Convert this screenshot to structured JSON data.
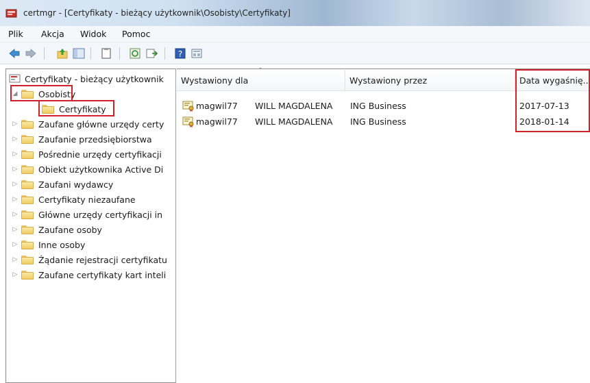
{
  "window": {
    "title": "certmgr - [Certyfikaty - bieżący użytkownik\\Osobisty\\Certyfikaty]"
  },
  "menu": {
    "items": [
      "Plik",
      "Akcja",
      "Widok",
      "Pomoc"
    ]
  },
  "toolbar": {
    "icons": [
      "back-icon",
      "forward-icon",
      "up-folder-icon",
      "show-hide-tree-icon",
      "clipboard-icon",
      "refresh-icon",
      "export-list-icon",
      "help-icon",
      "console-view-icon"
    ]
  },
  "tree": {
    "root": "Certyfikaty - bieżący użytkownik",
    "items": [
      {
        "label": "Osobisty",
        "expanded": true
      },
      {
        "label": "Certyfikaty",
        "child": true,
        "selected": true
      },
      {
        "label": "Zaufane główne urzędy certy"
      },
      {
        "label": "Zaufanie przedsiębiorstwa"
      },
      {
        "label": "Pośrednie urzędy certyfikacji"
      },
      {
        "label": "Obiekt użytkownika Active Di"
      },
      {
        "label": "Zaufani wydawcy"
      },
      {
        "label": "Certyfikaty niezaufane"
      },
      {
        "label": "Główne urzędy certyfikacji in"
      },
      {
        "label": "Zaufane osoby"
      },
      {
        "label": "Inne osoby"
      },
      {
        "label": "Żądanie rejestracji certyfikatu"
      },
      {
        "label": "Zaufane certyfikaty kart inteli"
      }
    ]
  },
  "list": {
    "columns": [
      "Wystawiony dla",
      "Wystawiony przez",
      "Data wygaśnię..."
    ],
    "sort_indicator": "^",
    "rows": [
      {
        "issued_to": "magwil77",
        "name": "WILL MAGDALENA",
        "issued_by": "ING Business",
        "expires": "2017-07-13"
      },
      {
        "issued_to": "magwil77",
        "name": "WILL MAGDALENA",
        "issued_by": "ING Business",
        "expires": "2018-01-14"
      }
    ]
  },
  "colors": {
    "highlight": "#d31f2a",
    "folder": "#f0cd66"
  }
}
